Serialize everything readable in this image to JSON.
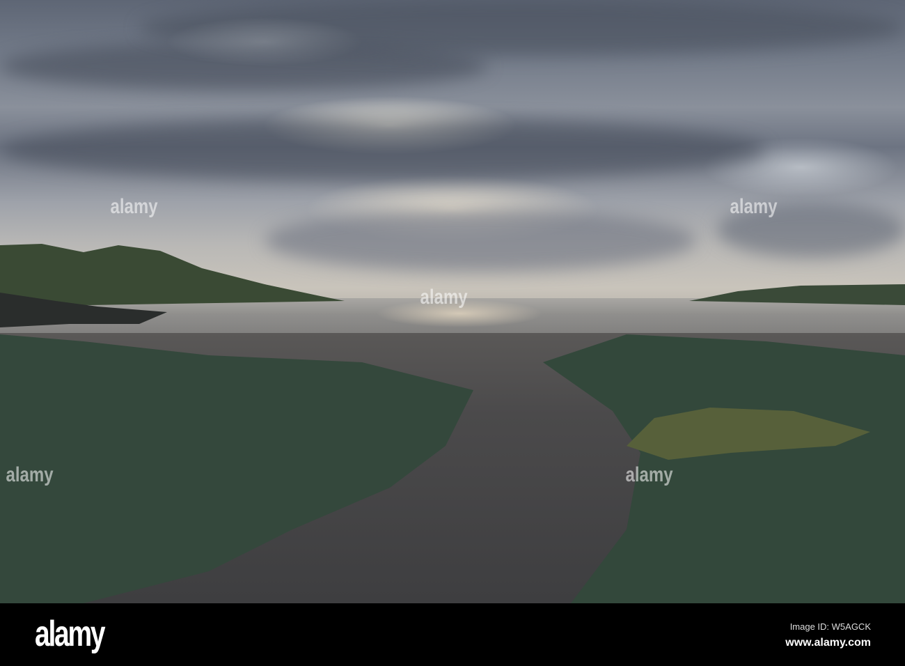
{
  "footer": {
    "logo": "alamy",
    "image_id": "Image ID: W5AGCK",
    "website": "www.alamy.com"
  },
  "watermark": "alamy",
  "colors": {
    "sky": "#737b89",
    "sea": "#8f8e8c",
    "sand": "#4b4a4b",
    "grass": "#3d5a45"
  }
}
